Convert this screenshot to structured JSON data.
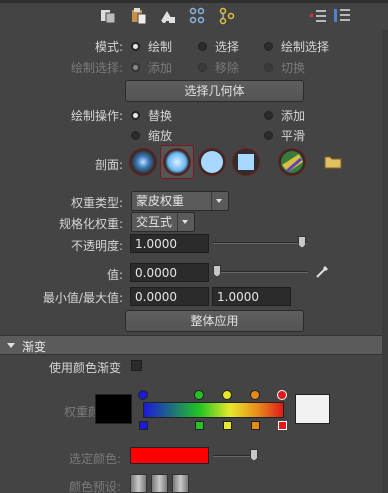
{
  "mode": {
    "label": "模式:",
    "options": [
      {
        "label": "绘制",
        "selected": true
      },
      {
        "label": "选择",
        "selected": false
      },
      {
        "label": "绘制选择",
        "selected": false
      }
    ]
  },
  "paint_select": {
    "label": "绘制选择:",
    "options": [
      {
        "label": "添加",
        "selected": true
      },
      {
        "label": "移除",
        "selected": false
      },
      {
        "label": "切换",
        "selected": false
      }
    ]
  },
  "select_geometry_button": "选择几何体",
  "paint_operation": {
    "label": "绘制操作:",
    "options": [
      {
        "label": "替换",
        "selected": true
      },
      {
        "label": "添加",
        "selected": false
      },
      {
        "label": "缩放",
        "selected": false
      },
      {
        "label": "平滑",
        "selected": false
      }
    ]
  },
  "profile_label": "剖面:",
  "weight_type": {
    "label": "权重类型:",
    "value": "蒙皮权重"
  },
  "normalize_weights": {
    "label": "规格化权重:",
    "value": "交互式"
  },
  "opacity": {
    "label": "不透明度:",
    "value": "1.0000",
    "slider": 0.95
  },
  "value": {
    "label": "值:",
    "value": "0.0000",
    "slider": 0.0
  },
  "min_max": {
    "label": "最小值/最大值:",
    "min": "0.0000",
    "max": "1.0000"
  },
  "flood_button": "整体应用",
  "gradient_section": {
    "title": "渐变",
    "use_color_ramp": "使用颜色渐变",
    "weight_color": "权重颜色:",
    "selected_color": "选定颜色:",
    "color_presets": "颜色预设:",
    "ramp_keys": [
      "#1a1ad9",
      "#22c422",
      "#e8e82a",
      "#e88a1a",
      "#e01a1a"
    ],
    "selected_color_hex": "#ff0000"
  },
  "colors": {
    "accent_red": "#7b1a1a",
    "bg": "#444444"
  }
}
